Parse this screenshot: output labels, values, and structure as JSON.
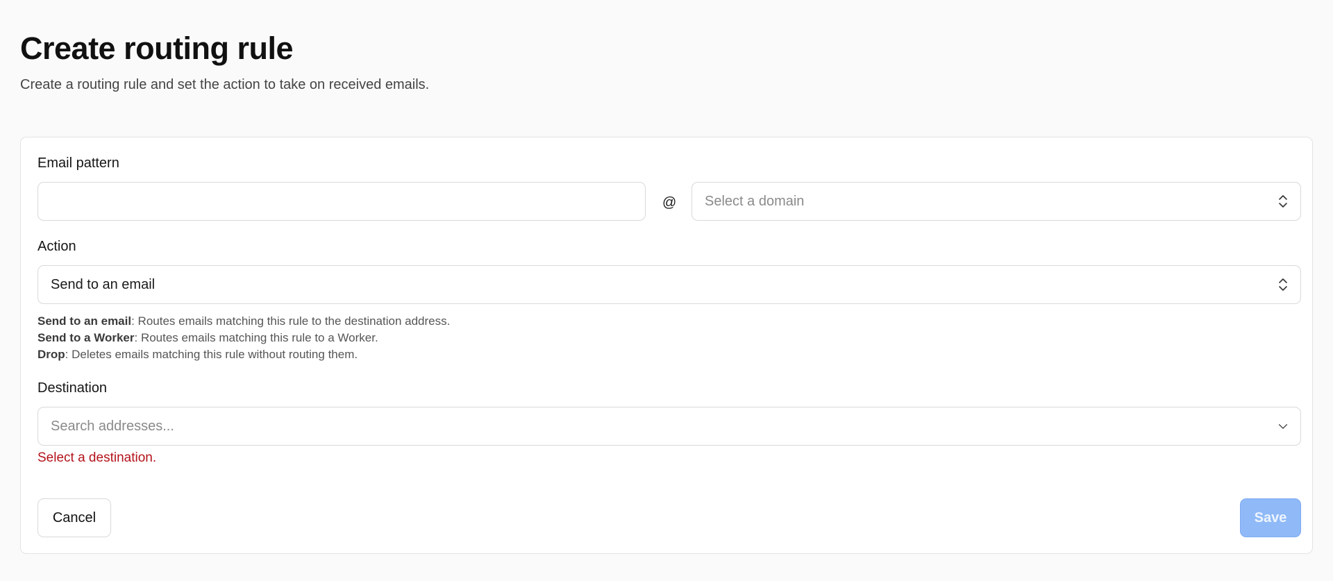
{
  "header": {
    "title": "Create routing rule",
    "subtitle": "Create a routing rule and set the action to take on received emails."
  },
  "form": {
    "email_pattern": {
      "label": "Email pattern",
      "value": "",
      "at_symbol": "@",
      "domain_placeholder": "Select a domain"
    },
    "action": {
      "label": "Action",
      "selected": "Send to an email",
      "help": [
        {
          "term": "Send to an email",
          "description": ": Routes emails matching this rule to the destination address."
        },
        {
          "term": "Send to a Worker",
          "description": ": Routes emails matching this rule to a Worker."
        },
        {
          "term": "Drop",
          "description": ": Deletes emails matching this rule without routing them."
        }
      ]
    },
    "destination": {
      "label": "Destination",
      "placeholder": "Search addresses...",
      "error": "Select a destination."
    }
  },
  "buttons": {
    "cancel": "Cancel",
    "save": "Save"
  },
  "icons": {
    "select_chevrons": "up-down-chevron-icon",
    "combobox_chevron": "chevron-down-icon"
  },
  "colors": {
    "error": "#b3121b",
    "save_disabled": "#8fbaf7"
  }
}
